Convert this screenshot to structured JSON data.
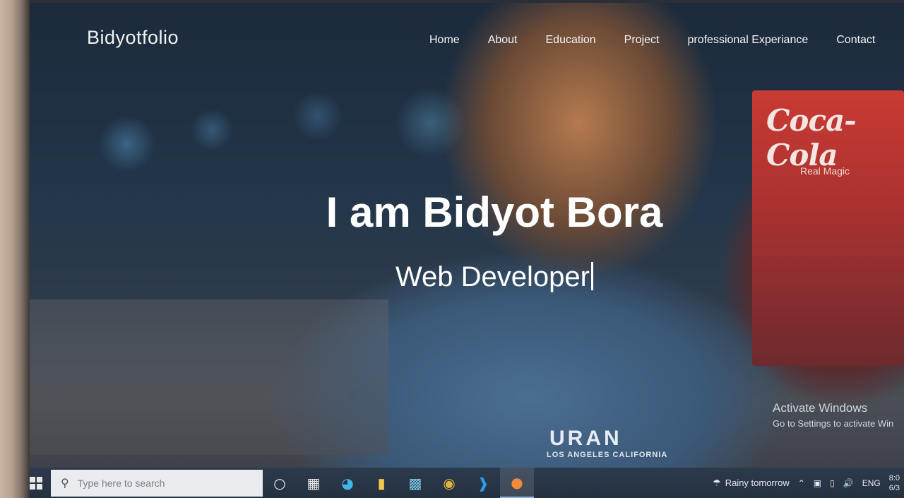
{
  "site": {
    "brand": "Bidyotfolio",
    "nav": [
      "Home",
      "About",
      "Education",
      "Project",
      "professional Experiance",
      "Contact"
    ],
    "hero_title": "I am Bidyot Bora",
    "hero_subtitle": "Web Developer"
  },
  "background": {
    "poster_brand": "Coca-Cola",
    "poster_tagline": "Real Magic",
    "shirt_text": "URAN",
    "shirt_subtext": "LOS ANGELES CALIFORNIA"
  },
  "watermark": {
    "title": "Activate Windows",
    "subtitle": "Go to Settings to activate Win"
  },
  "taskbar": {
    "search_placeholder": "Type here to search",
    "apps": [
      "cortana-icon",
      "task-view-icon",
      "edge-icon",
      "file-explorer-icon",
      "photos-icon",
      "chrome-icon",
      "vscode-icon",
      "firefox-icon"
    ],
    "weather": "Rainy tomorrow",
    "language": "ENG",
    "time": "8:0",
    "date": "6/3"
  }
}
